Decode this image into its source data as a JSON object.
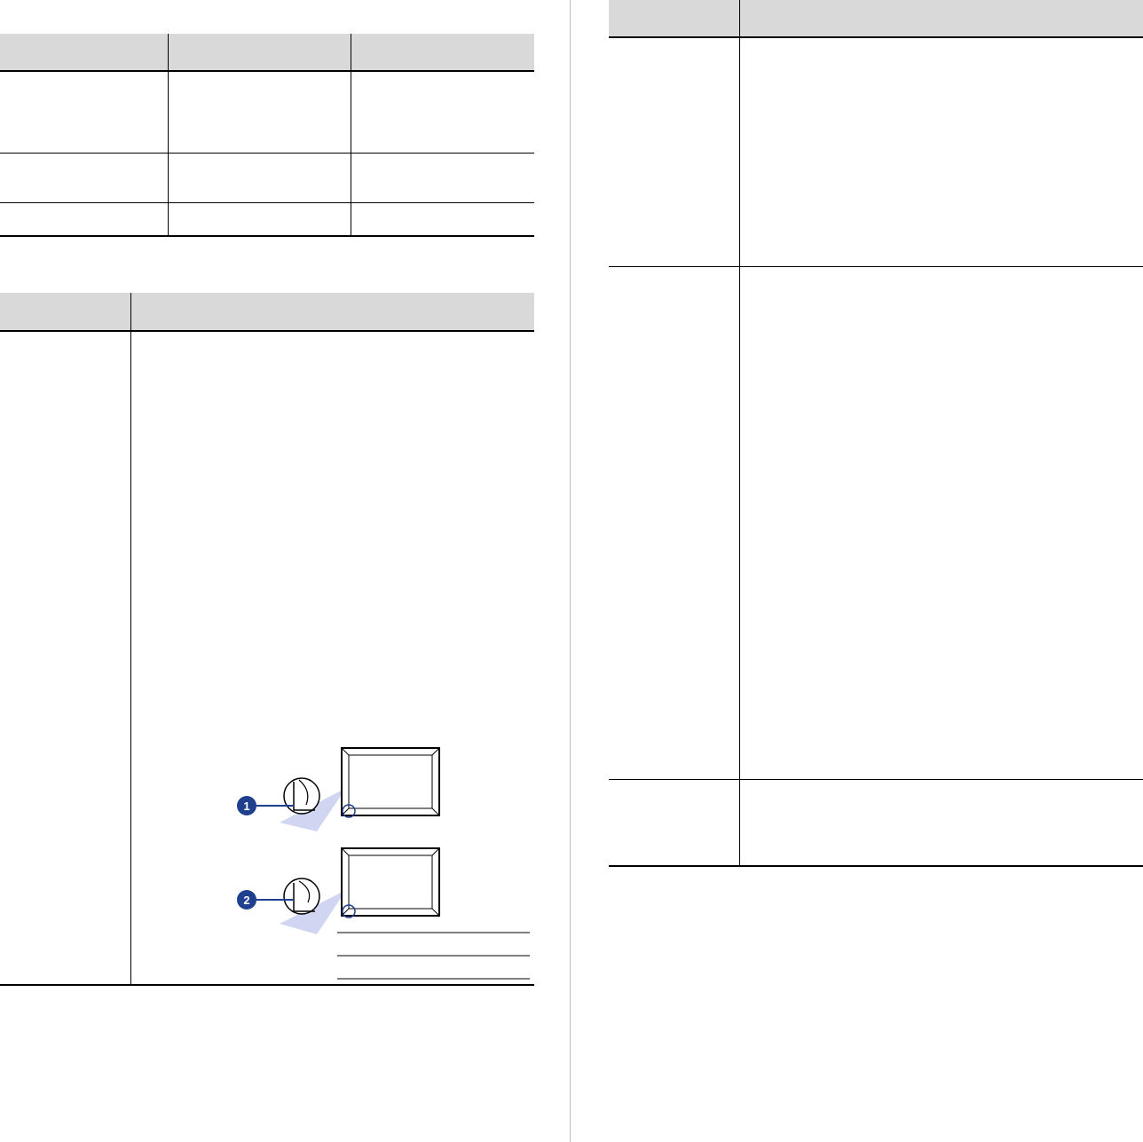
{
  "page": {
    "background": "#ffffff",
    "header_fill": "#d9d9d9",
    "rule_color": "#000000",
    "column_divider_color": "#bdbdbd"
  },
  "table_top_left": {
    "columns": [
      "",
      "",
      ""
    ],
    "rows": [
      [
        "",
        "",
        ""
      ],
      [
        "",
        "",
        ""
      ],
      [
        "",
        "",
        ""
      ]
    ]
  },
  "table_envelope": {
    "columns": [
      "",
      ""
    ],
    "rows": [
      [
        "",
        ""
      ]
    ]
  },
  "envelope_figure": {
    "callouts": [
      {
        "number": "1",
        "icon": "envelope-diagonal-seam-icon"
      },
      {
        "number": "2",
        "icon": "envelope-side-seam-icon"
      }
    ],
    "callout_color": "#1f3f8f",
    "magnifier_color": "#c8cfee"
  },
  "table_right": {
    "columns": [
      "",
      ""
    ],
    "rows": [
      [
        "",
        ""
      ],
      [
        "",
        ""
      ],
      [
        "",
        ""
      ]
    ]
  }
}
